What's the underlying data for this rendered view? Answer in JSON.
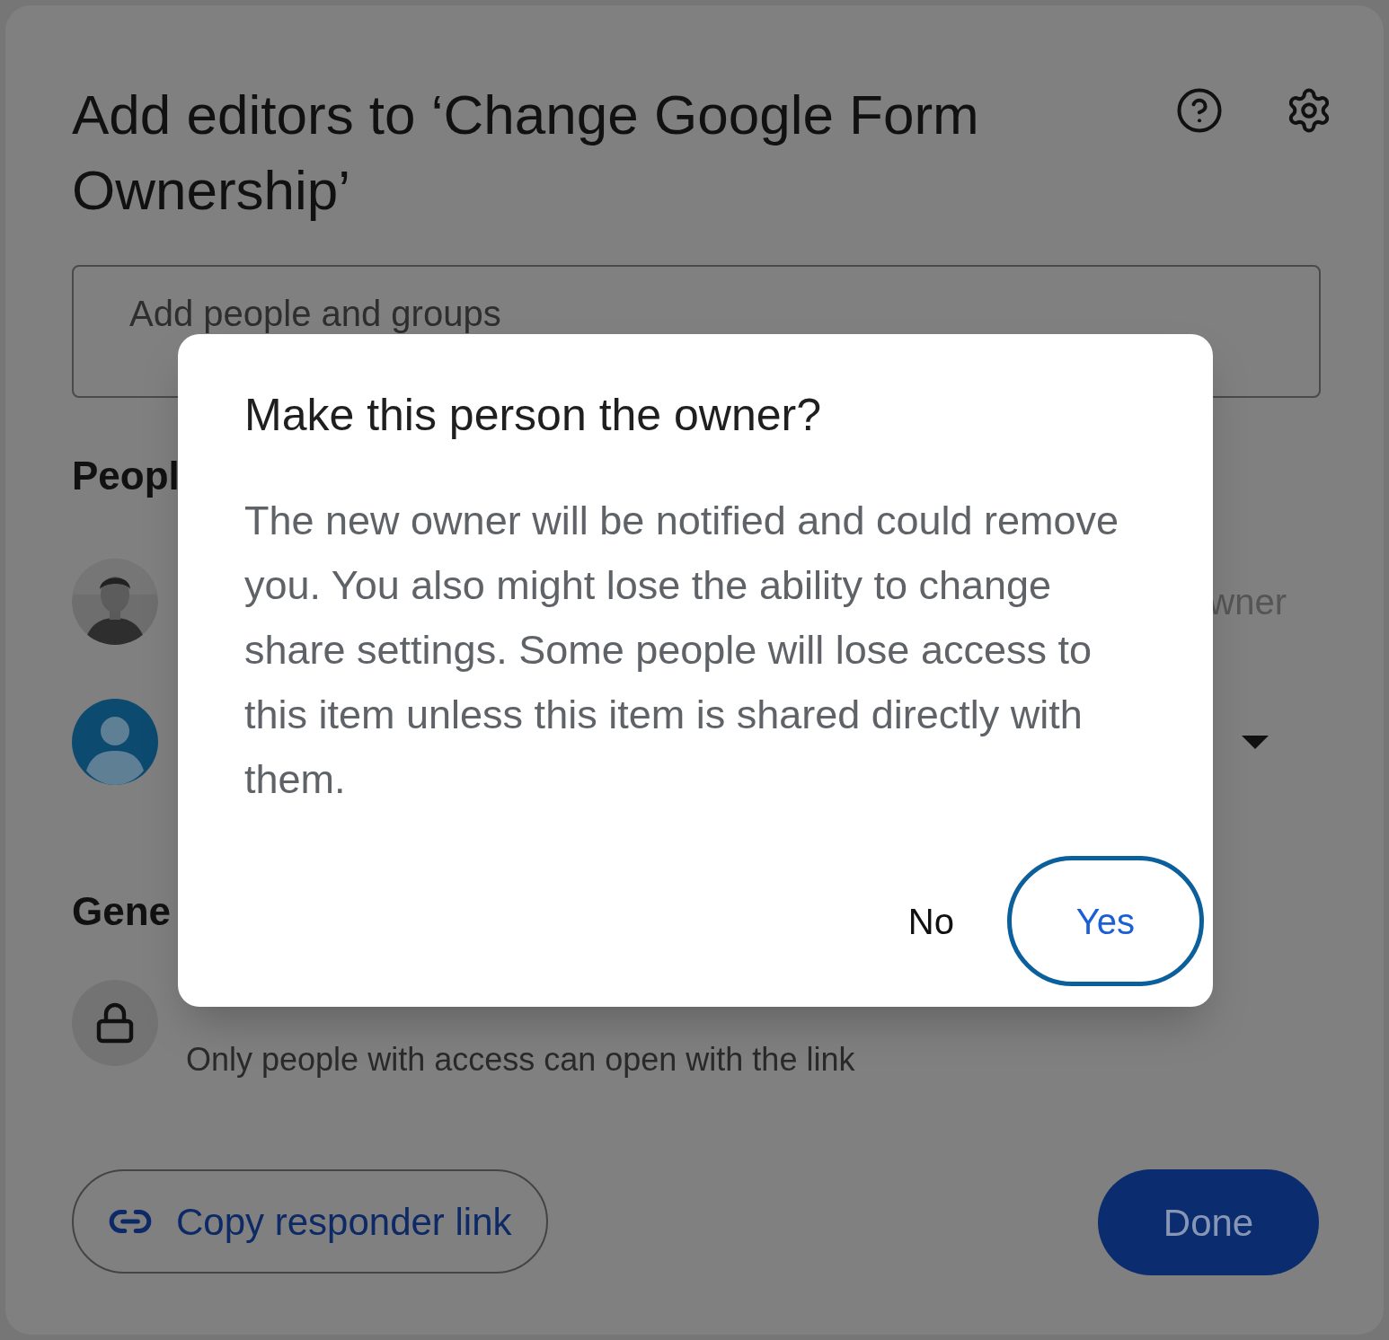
{
  "sheet": {
    "title": "Add editors to ‘Change Google Form Ownership’",
    "field": {
      "placeholder": "Add people and groups"
    },
    "people_heading": "Peopl",
    "people": [
      {
        "role": "wner",
        "dropdown": false
      },
      {
        "kind": "silhouette",
        "dropdown": true
      }
    ],
    "general_heading": "Gene",
    "access": {
      "description": "Only people with access can open with the link"
    },
    "buttons": [
      {
        "kind": "outline",
        "label": "Copy responder link"
      },
      {
        "kind": "filled",
        "label": "Done"
      }
    ]
  },
  "dialog": {
    "title": "Make this person the owner?",
    "body": "The new owner will be notified and could remove you. You also might lose the ability to change share settings. Some people will lose access to this item unless this item is shared directly with them.",
    "buttons": [
      {
        "label": "No",
        "selected": false
      },
      {
        "label": "Yes",
        "selected": true
      }
    ]
  }
}
